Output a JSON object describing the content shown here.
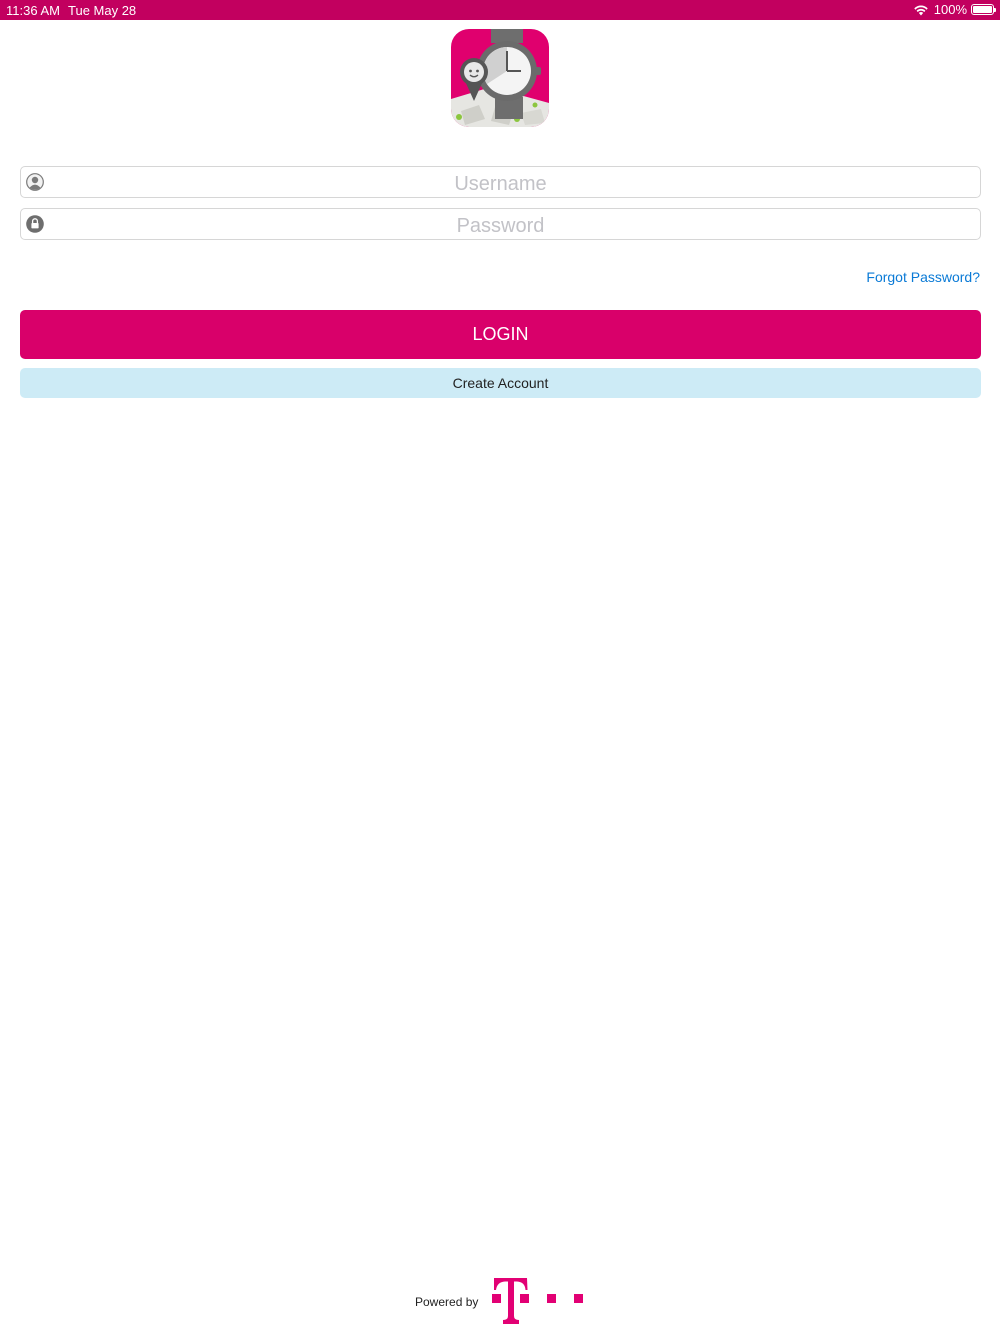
{
  "status_bar": {
    "time": "11:36 AM",
    "date": "Tue May 28",
    "battery": "100%",
    "icons": [
      "wifi-icon",
      "battery-icon"
    ]
  },
  "app_logo": {
    "icon": "kids-watch-app-icon"
  },
  "login_form": {
    "username_placeholder": "Username",
    "password_placeholder": "Password",
    "username_icon": "user-icon",
    "password_icon": "lock-icon",
    "forgot_password": "Forgot Password?",
    "login_label": "LOGIN",
    "create_account_label": "Create Account"
  },
  "footer": {
    "powered_by": "Powered by",
    "logo": "telekom-t-logo"
  },
  "colors": {
    "brand_magenta": "#d9006a",
    "status_bar": "#c2005f",
    "link_blue": "#0a7ad6",
    "secondary_button": "#cdebf6"
  }
}
